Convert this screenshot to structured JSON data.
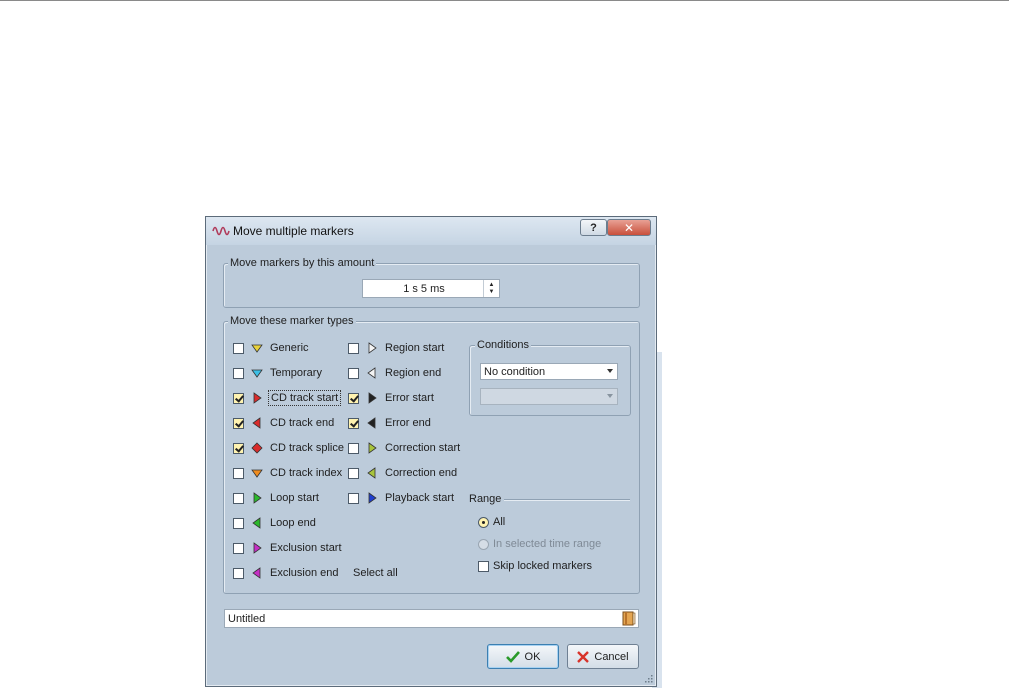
{
  "dialog": {
    "title": "Move multiple markers",
    "help_label": "?",
    "close_label": "✕"
  },
  "move_amount": {
    "group_label": "Move markers by this amount",
    "value": "1 s 5 ms"
  },
  "marker_types": {
    "group_label": "Move these marker types",
    "left_column": [
      {
        "label": "Generic",
        "checked": false,
        "color": "#e8d23c"
      },
      {
        "label": "Temporary",
        "checked": false,
        "color": "#3cbfe6"
      },
      {
        "label": "CD track start",
        "checked": true,
        "color": "#d92b2b"
      },
      {
        "label": "CD track end",
        "checked": true,
        "color": "#d92b2b"
      },
      {
        "label": "CD track splice",
        "checked": true,
        "color": "#d92b2b"
      },
      {
        "label": "CD track index",
        "checked": false,
        "color": "#f08c1e"
      },
      {
        "label": "Loop start",
        "checked": false,
        "color": "#2bb82b"
      },
      {
        "label": "Loop end",
        "checked": false,
        "color": "#2bb82b"
      },
      {
        "label": "Exclusion start",
        "checked": false,
        "color": "#c42fc4"
      },
      {
        "label": "Exclusion end",
        "checked": false,
        "color": "#c42fc4"
      }
    ],
    "right_column": [
      {
        "label": "Region start",
        "checked": false,
        "color": "#f4f4f4"
      },
      {
        "label": "Region end",
        "checked": false,
        "color": "#f4f4f4"
      },
      {
        "label": "Error start",
        "checked": true,
        "color": "#222222"
      },
      {
        "label": "Error end",
        "checked": true,
        "color": "#222222"
      },
      {
        "label": "Correction start",
        "checked": false,
        "color": "#a8c43c"
      },
      {
        "label": "Correction end",
        "checked": false,
        "color": "#a8c43c"
      },
      {
        "label": "Playback start",
        "checked": false,
        "color": "#1f3fcf"
      }
    ],
    "select_all_label": "Select all"
  },
  "conditions": {
    "group_label": "Conditions",
    "selected": "No condition",
    "secondary": ""
  },
  "range": {
    "label": "Range",
    "options": [
      {
        "label": "All",
        "selected": true,
        "enabled": true
      },
      {
        "label": "In selected time range",
        "selected": false,
        "enabled": false
      }
    ],
    "skip_locked_label": "Skip locked markers",
    "skip_locked_checked": false
  },
  "preset": {
    "value": "Untitled"
  },
  "buttons": {
    "ok_label": "OK",
    "cancel_label": "Cancel"
  }
}
